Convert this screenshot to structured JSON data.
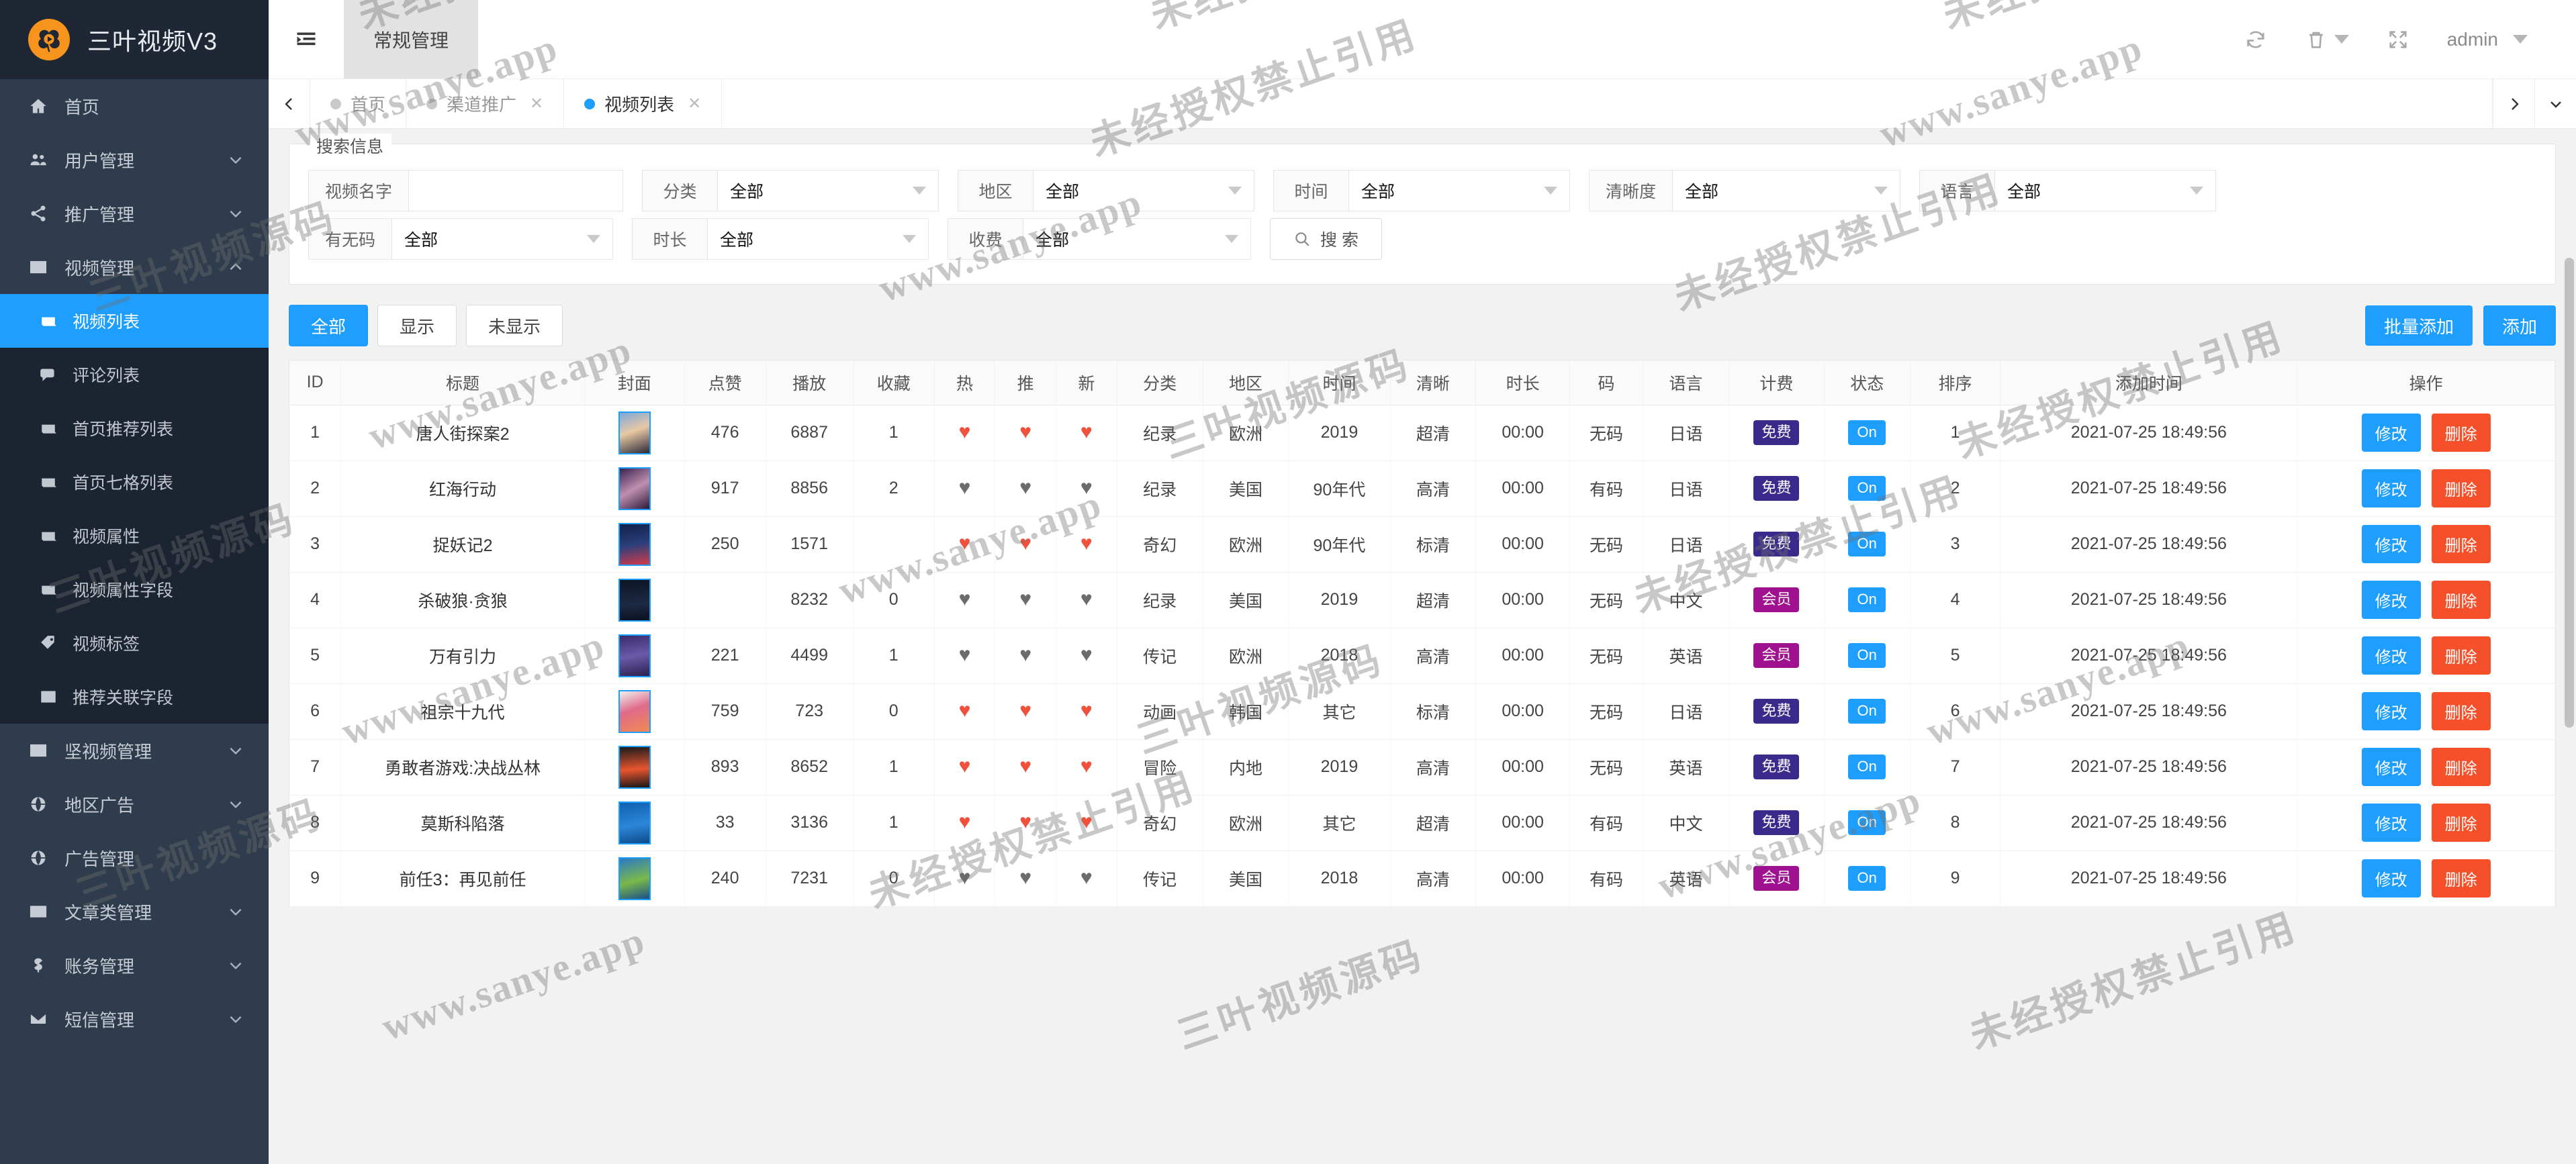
{
  "brand": {
    "title": "三叶视频V3",
    "logo_icon": "clover-play-logo"
  },
  "sidebar": {
    "items": [
      {
        "label": "首页",
        "icon": "home-icon",
        "caret": false
      },
      {
        "label": "用户管理",
        "icon": "users-icon",
        "caret": true
      },
      {
        "label": "推广管理",
        "icon": "share-icon",
        "caret": true
      },
      {
        "label": "视频管理",
        "icon": "film-icon",
        "caret": true,
        "expanded": true
      }
    ],
    "video_submenu": [
      {
        "label": "视频列表",
        "icon": "book-icon",
        "active": true
      },
      {
        "label": "评论列表",
        "icon": "comment-icon",
        "active": false
      },
      {
        "label": "首页推荐列表",
        "icon": "book-icon",
        "active": false
      },
      {
        "label": "首页七格列表",
        "icon": "book-icon",
        "active": false
      },
      {
        "label": "视频属性",
        "icon": "book-icon",
        "active": false
      },
      {
        "label": "视频属性字段",
        "icon": "book-icon",
        "active": false
      },
      {
        "label": "视频标签",
        "icon": "tag-icon",
        "active": false
      },
      {
        "label": "推荐关联字段",
        "icon": "columns-icon",
        "active": false
      }
    ],
    "items_after": [
      {
        "label": "坚视频管理",
        "icon": "film-icon",
        "caret": true
      },
      {
        "label": "地区广告",
        "icon": "globe-icon",
        "caret": true
      },
      {
        "label": "广告管理",
        "icon": "globe-icon",
        "caret": false
      },
      {
        "label": "文章类管理",
        "icon": "mail-icon",
        "caret": true
      },
      {
        "label": "账务管理",
        "icon": "dollar-icon",
        "caret": true
      },
      {
        "label": "短信管理",
        "icon": "mail-icon",
        "caret": true
      }
    ]
  },
  "topbar": {
    "collapse_icon": "collapse-menu-icon",
    "module_tab": "常规管理",
    "actions": [
      {
        "name": "refresh-icon"
      },
      {
        "name": "trash-icon",
        "caret": true
      },
      {
        "name": "fullscreen-icon"
      }
    ],
    "user": "admin"
  },
  "tabs": {
    "prev_icon": "chevron-left-icon",
    "next_icon": "chevron-right-icon",
    "more_icon": "chevron-down-icon",
    "items": [
      {
        "label": "首页",
        "active": false,
        "closable": false
      },
      {
        "label": "渠道推广",
        "active": false,
        "closable": true
      },
      {
        "label": "视频列表",
        "active": true,
        "closable": true
      }
    ]
  },
  "search": {
    "legend": "搜索信息",
    "fields": [
      {
        "key": "video_name",
        "label": "视频名字",
        "type": "input",
        "value": "",
        "placeholder": ""
      },
      {
        "key": "category",
        "label": "分类",
        "type": "select",
        "value": "全部"
      },
      {
        "key": "area",
        "label": "地区",
        "type": "select",
        "value": "全部"
      },
      {
        "key": "time",
        "label": "时间",
        "type": "select",
        "value": "全部"
      },
      {
        "key": "clarity",
        "label": "清晰度",
        "type": "select",
        "value": "全部"
      },
      {
        "key": "language",
        "label": "语言",
        "type": "select",
        "value": "全部"
      },
      {
        "key": "has_code",
        "label": "有无码",
        "type": "select",
        "value": "全部"
      },
      {
        "key": "duration",
        "label": "时长",
        "type": "select",
        "value": "全部"
      },
      {
        "key": "fee",
        "label": "收费",
        "type": "select",
        "value": "全部"
      }
    ],
    "search_button": "搜 索",
    "search_icon": "search-icon"
  },
  "toolbar": {
    "filters": [
      {
        "label": "全部",
        "active": true
      },
      {
        "label": "显示",
        "active": false
      },
      {
        "label": "未显示",
        "active": false
      }
    ],
    "batch_add": "批量添加",
    "add": "添加"
  },
  "table": {
    "headers": [
      "ID",
      "标题",
      "封面",
      "点赞",
      "播放",
      "收藏",
      "热",
      "推",
      "新",
      "分类",
      "地区",
      "时间",
      "清晰",
      "时长",
      "码",
      "语言",
      "计费",
      "状态",
      "排序",
      "添加时间",
      "操作"
    ],
    "op_edit": "修改",
    "op_delete": "删除",
    "rows": [
      {
        "id": "1",
        "title": "唐人街探案2",
        "thumb": "c1",
        "likes": "476",
        "plays": "6887",
        "favs": "1",
        "hot": true,
        "rec": true,
        "new": true,
        "category": "纪录",
        "area": "欧洲",
        "year": "2019",
        "clarity": "超清",
        "duration": "00:00",
        "code": "无码",
        "lang": "日语",
        "fee": "免费",
        "fee_type": "free",
        "status": "On",
        "sort": "1",
        "added": "2021-07-25 18:49:56"
      },
      {
        "id": "2",
        "title": "红海行动",
        "thumb": "c2",
        "likes": "917",
        "plays": "8856",
        "favs": "2",
        "hot": false,
        "rec": false,
        "new": false,
        "category": "纪录",
        "area": "美国",
        "year": "90年代",
        "clarity": "高清",
        "duration": "00:00",
        "code": "有码",
        "lang": "日语",
        "fee": "免费",
        "fee_type": "free",
        "status": "On",
        "sort": "2",
        "added": "2021-07-25 18:49:56"
      },
      {
        "id": "3",
        "title": "捉妖记2",
        "thumb": "c3",
        "likes": "250",
        "plays": "1571",
        "favs": "",
        "hot": true,
        "rec": true,
        "new": true,
        "category": "奇幻",
        "area": "欧洲",
        "year": "90年代",
        "clarity": "标清",
        "duration": "00:00",
        "code": "无码",
        "lang": "日语",
        "fee": "免费",
        "fee_type": "free",
        "status": "On",
        "sort": "3",
        "added": "2021-07-25 18:49:56"
      },
      {
        "id": "4",
        "title": "杀破狼·贪狼",
        "thumb": "c4",
        "likes": "",
        "plays": "8232",
        "favs": "0",
        "hot": false,
        "rec": false,
        "new": false,
        "category": "纪录",
        "area": "美国",
        "year": "2019",
        "clarity": "超清",
        "duration": "00:00",
        "code": "无码",
        "lang": "中文",
        "fee": "会员",
        "fee_type": "vip",
        "status": "On",
        "sort": "4",
        "added": "2021-07-25 18:49:56"
      },
      {
        "id": "5",
        "title": "万有引力",
        "thumb": "c5",
        "likes": "221",
        "plays": "4499",
        "favs": "1",
        "hot": false,
        "rec": false,
        "new": false,
        "category": "传记",
        "area": "欧洲",
        "year": "2018",
        "clarity": "高清",
        "duration": "00:00",
        "code": "无码",
        "lang": "英语",
        "fee": "会员",
        "fee_type": "vip",
        "status": "On",
        "sort": "5",
        "added": "2021-07-25 18:49:56"
      },
      {
        "id": "6",
        "title": "祖宗十九代",
        "thumb": "c6",
        "likes": "759",
        "plays": "723",
        "favs": "0",
        "hot": true,
        "rec": true,
        "new": true,
        "category": "动画",
        "area": "韩国",
        "year": "其它",
        "clarity": "标清",
        "duration": "00:00",
        "code": "无码",
        "lang": "日语",
        "fee": "免费",
        "fee_type": "free",
        "status": "On",
        "sort": "6",
        "added": "2021-07-25 18:49:56"
      },
      {
        "id": "7",
        "title": "勇敢者游戏:决战丛林",
        "thumb": "c7",
        "likes": "893",
        "plays": "8652",
        "favs": "1",
        "hot": true,
        "rec": true,
        "new": true,
        "category": "冒险",
        "area": "内地",
        "year": "2019",
        "clarity": "高清",
        "duration": "00:00",
        "code": "无码",
        "lang": "英语",
        "fee": "免费",
        "fee_type": "free",
        "status": "On",
        "sort": "7",
        "added": "2021-07-25 18:49:56"
      },
      {
        "id": "8",
        "title": "莫斯科陷落",
        "thumb": "c8",
        "likes": "33",
        "plays": "3136",
        "favs": "1",
        "hot": true,
        "rec": true,
        "new": true,
        "category": "奇幻",
        "area": "欧洲",
        "year": "其它",
        "clarity": "超清",
        "duration": "00:00",
        "code": "有码",
        "lang": "中文",
        "fee": "免费",
        "fee_type": "free",
        "status": "On",
        "sort": "8",
        "added": "2021-07-25 18:49:56"
      },
      {
        "id": "9",
        "title": "前任3：再见前任",
        "thumb": "c9",
        "likes": "240",
        "plays": "7231",
        "favs": "0",
        "hot": false,
        "rec": false,
        "new": false,
        "category": "传记",
        "area": "美国",
        "year": "2018",
        "clarity": "高清",
        "duration": "00:00",
        "code": "有码",
        "lang": "英语",
        "fee": "会员",
        "fee_type": "vip",
        "status": "On",
        "sort": "9",
        "added": "2021-07-25 18:49:56"
      }
    ]
  },
  "watermarks": {
    "text_a": "www.sanye.app",
    "text_b": "未经授权禁止引用",
    "text_c": "三叶视频源码"
  },
  "colors": {
    "accent": "#1e9fff",
    "danger": "#f6502a",
    "sidebar": "#2f3c4d",
    "sidebar_dark": "#1c2431",
    "brand_orange": "#f7941e",
    "badge_free": "#3b2a8c",
    "badge_vip": "#a0118f",
    "heart_on": "#f0513c"
  }
}
